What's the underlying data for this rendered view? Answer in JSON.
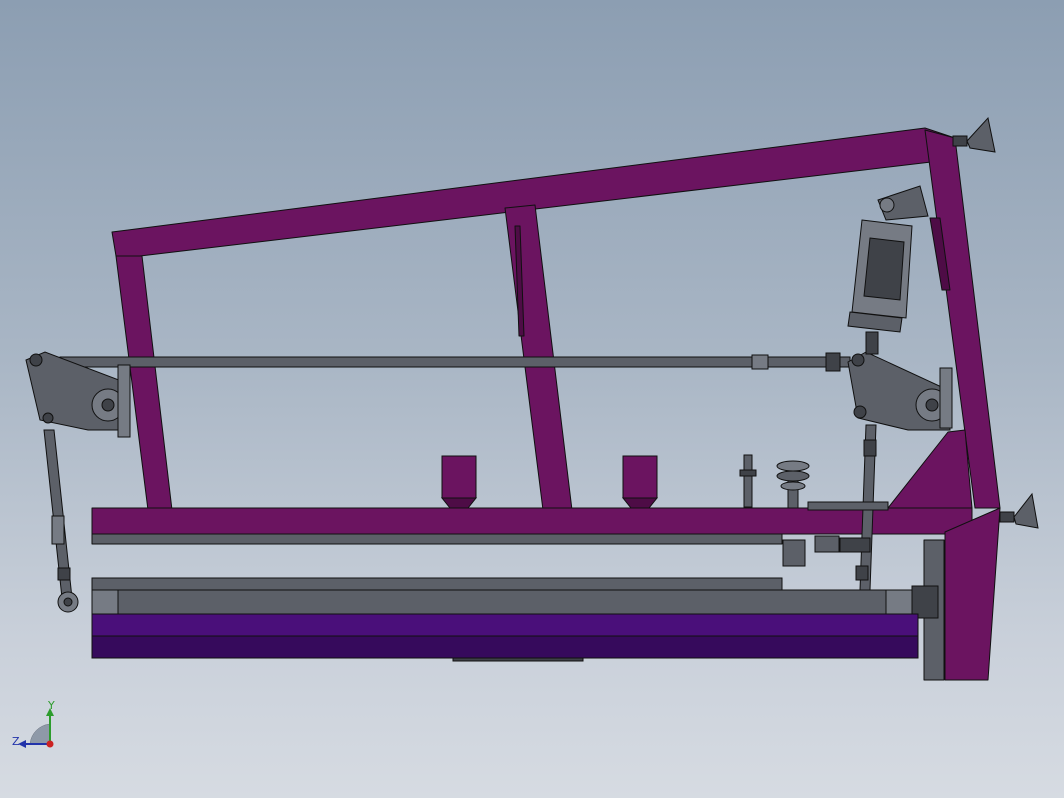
{
  "viewport": {
    "background_top": "#8c9eb2",
    "background_bottom": "#d6dbe2"
  },
  "colors": {
    "frame": "#6b1460",
    "frame_dark": "#4e0c46",
    "steel": "#5c6068",
    "steel_light": "#767b84",
    "steel_dark": "#3f4248",
    "belt": "#4a0f7a",
    "belt_dark": "#360a5c",
    "outline": "#101010"
  },
  "triad": {
    "y_label": "Y",
    "z_label": "Z",
    "y_color": "#2c9c2c",
    "z_color": "#2233aa",
    "x_color": "#cc2222"
  }
}
